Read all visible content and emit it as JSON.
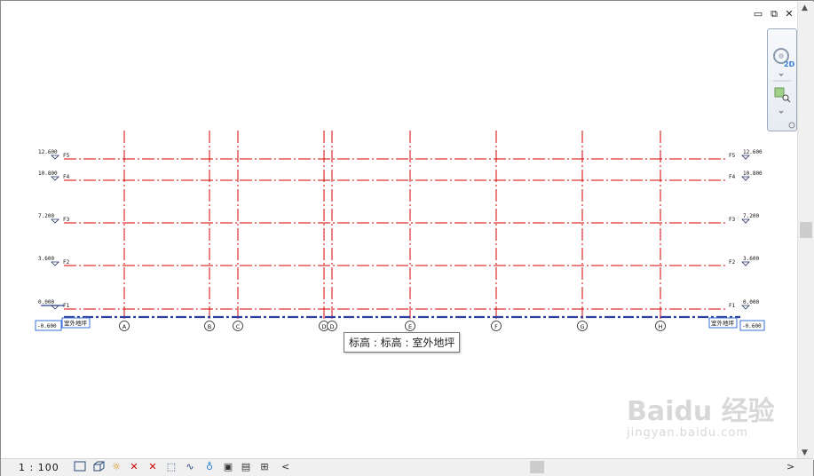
{
  "window": {
    "controls": {
      "minimize_glyph": "▭",
      "restore_glyph": "⧉",
      "close_glyph": "✕"
    }
  },
  "navigation_bar": {
    "wheel_label": "2D"
  },
  "view": {
    "gridline_color": "#d40000",
    "level_color": "#2c3f9e",
    "levels_left": [
      {
        "elevation": "12.600",
        "name": "F5"
      },
      {
        "elevation": "10.800",
        "name": "F4"
      },
      {
        "elevation": "7.200",
        "name": "F3"
      },
      {
        "elevation": "3.600",
        "name": "F2"
      },
      {
        "elevation": "0.000",
        "name": "F1"
      }
    ],
    "levels_right": [
      {
        "elevation": "12.600",
        "name": "F5"
      },
      {
        "elevation": "10.800",
        "name": "F4"
      },
      {
        "elevation": "7.200",
        "name": "F3"
      },
      {
        "elevation": "3.600",
        "name": "F2"
      },
      {
        "elevation": "0.000",
        "name": "F1"
      }
    ],
    "ground_level": {
      "elevation": "-0.600",
      "name": "室外地坪"
    },
    "grids": [
      "A",
      "B",
      "C",
      "D",
      "D",
      "E",
      "F",
      "G",
      "H"
    ],
    "tooltip": "标高 : 标高 : 室外地坪"
  },
  "status_bar": {
    "scale": "1 : 100"
  },
  "watermark": {
    "brand": "Baidu 经验",
    "url": "jingyan.baidu.com"
  }
}
